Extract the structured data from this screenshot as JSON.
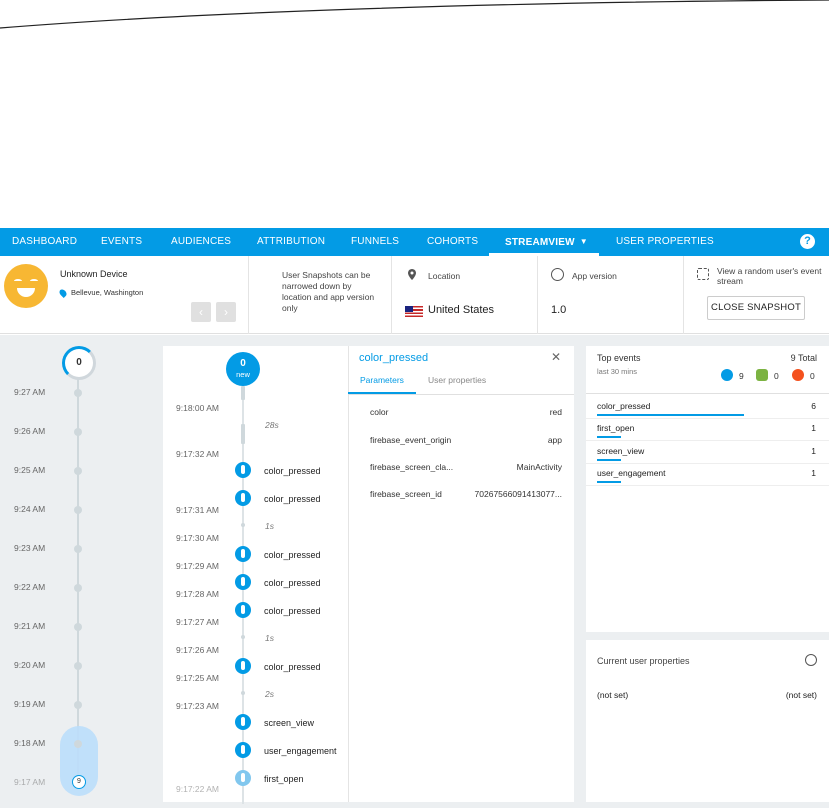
{
  "nav": {
    "tabs": [
      "DASHBOARD",
      "EVENTS",
      "AUDIENCES",
      "ATTRIBUTION",
      "FUNNELS",
      "COHORTS",
      "STREAMVIEW",
      "USER PROPERTIES"
    ],
    "active_tab": "STREAMVIEW",
    "help_icon": "?"
  },
  "device": {
    "name": "Unknown Device",
    "location": "Bellevue, Washington",
    "prev_icon": "‹",
    "next_icon": "›"
  },
  "snapshot_note": "User Snapshots can be narrowed down by location and app version only",
  "location": {
    "label": "Location",
    "value": "United States"
  },
  "app_version": {
    "label": "App version",
    "value": "1.0"
  },
  "random_stream": {
    "text": "View a random user's event stream",
    "button": "CLOSE SNAPSHOT"
  },
  "minute_timeline": {
    "badge": "0",
    "labels": [
      "9:27 AM",
      "9:26 AM",
      "9:25 AM",
      "9:24 AM",
      "9:23 AM",
      "9:22 AM",
      "9:21 AM",
      "9:20 AM",
      "9:19 AM",
      "9:18 AM",
      "9:17 AM"
    ],
    "selected_count": "9"
  },
  "stream": {
    "new_count": "0",
    "new_label": "new",
    "times": [
      "9:18:00 AM",
      "9:17:32 AM",
      "9:17:31 AM",
      "9:17:30 AM",
      "9:17:29 AM",
      "9:17:28 AM",
      "9:17:27 AM",
      "9:17:26 AM",
      "9:17:25 AM",
      "9:17:23 AM",
      "9:17:22 AM"
    ],
    "gaps": [
      "28s",
      "1s",
      "1s",
      "2s"
    ],
    "events": [
      "color_pressed",
      "color_pressed",
      "color_pressed",
      "color_pressed",
      "color_pressed",
      "color_pressed",
      "screen_view",
      "user_engagement",
      "first_open"
    ]
  },
  "params": {
    "title": "color_pressed",
    "close_icon": "✕",
    "tabs": [
      "Parameters",
      "User properties"
    ],
    "rows": [
      {
        "key": "color",
        "value": "red"
      },
      {
        "key": "firebase_event_origin",
        "value": "app"
      },
      {
        "key": "firebase_screen_cla...",
        "value": "MainActivity"
      },
      {
        "key": "firebase_screen_id",
        "value": "70267566091413077..."
      }
    ]
  },
  "top_events": {
    "title": "Top events",
    "total": "9 Total",
    "subtitle": "last 30 mins",
    "counts": [
      {
        "icon": "user-icon",
        "color": "#039be5",
        "value": "9"
      },
      {
        "icon": "flag-icon",
        "color": "#7cb342",
        "value": "0"
      },
      {
        "icon": "bug-icon",
        "color": "#f4511e",
        "value": "0"
      }
    ],
    "rows": [
      {
        "name": "color_pressed",
        "count": "6",
        "share": 0.667
      },
      {
        "name": "first_open",
        "count": "1",
        "share": 0.111
      },
      {
        "name": "screen_view",
        "count": "1",
        "share": 0.111
      },
      {
        "name": "user_engagement",
        "count": "1",
        "share": 0.111
      }
    ]
  },
  "user_properties": {
    "title": "Current user properties",
    "key": "(not set)",
    "value": "(not set)"
  },
  "colors": {
    "primary": "#039be5",
    "background": "#eceff1",
    "avatar": "#f7b733"
  }
}
